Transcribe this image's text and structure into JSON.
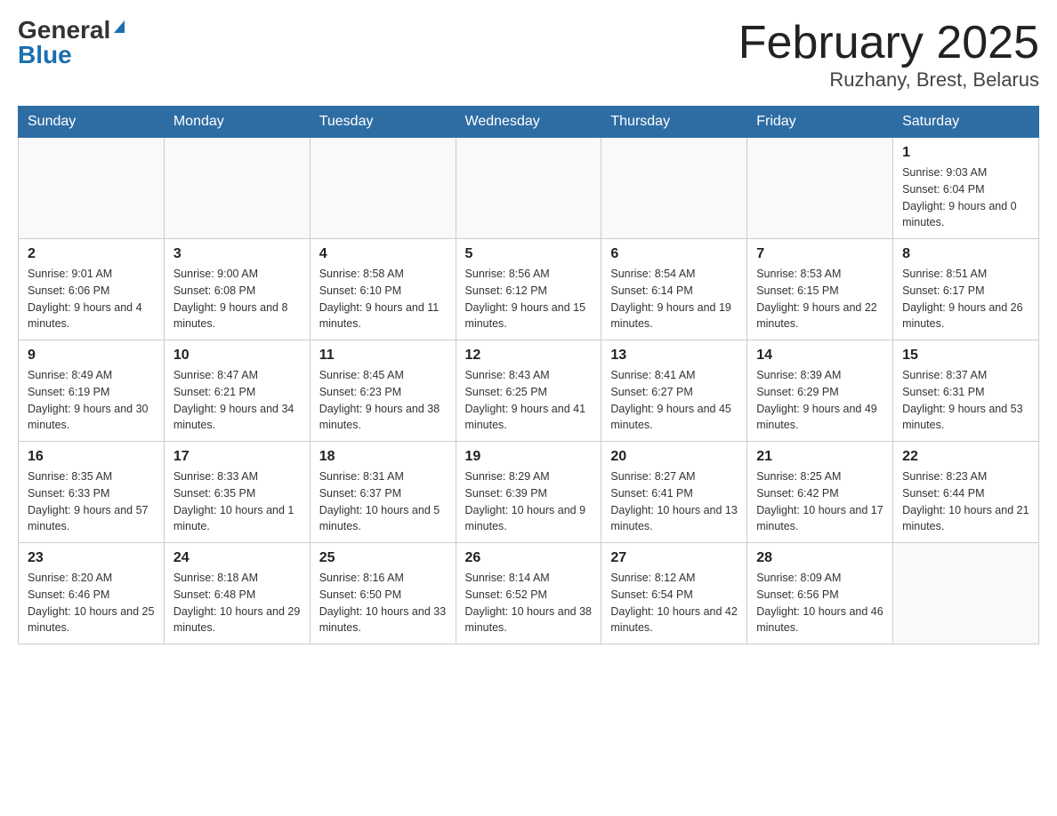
{
  "header": {
    "logo_general": "General",
    "logo_blue": "Blue",
    "month_title": "February 2025",
    "location": "Ruzhany, Brest, Belarus"
  },
  "weekdays": [
    "Sunday",
    "Monday",
    "Tuesday",
    "Wednesday",
    "Thursday",
    "Friday",
    "Saturday"
  ],
  "weeks": [
    [
      {
        "day": "",
        "info": ""
      },
      {
        "day": "",
        "info": ""
      },
      {
        "day": "",
        "info": ""
      },
      {
        "day": "",
        "info": ""
      },
      {
        "day": "",
        "info": ""
      },
      {
        "day": "",
        "info": ""
      },
      {
        "day": "1",
        "info": "Sunrise: 9:03 AM\nSunset: 6:04 PM\nDaylight: 9 hours and 0 minutes."
      }
    ],
    [
      {
        "day": "2",
        "info": "Sunrise: 9:01 AM\nSunset: 6:06 PM\nDaylight: 9 hours and 4 minutes."
      },
      {
        "day": "3",
        "info": "Sunrise: 9:00 AM\nSunset: 6:08 PM\nDaylight: 9 hours and 8 minutes."
      },
      {
        "day": "4",
        "info": "Sunrise: 8:58 AM\nSunset: 6:10 PM\nDaylight: 9 hours and 11 minutes."
      },
      {
        "day": "5",
        "info": "Sunrise: 8:56 AM\nSunset: 6:12 PM\nDaylight: 9 hours and 15 minutes."
      },
      {
        "day": "6",
        "info": "Sunrise: 8:54 AM\nSunset: 6:14 PM\nDaylight: 9 hours and 19 minutes."
      },
      {
        "day": "7",
        "info": "Sunrise: 8:53 AM\nSunset: 6:15 PM\nDaylight: 9 hours and 22 minutes."
      },
      {
        "day": "8",
        "info": "Sunrise: 8:51 AM\nSunset: 6:17 PM\nDaylight: 9 hours and 26 minutes."
      }
    ],
    [
      {
        "day": "9",
        "info": "Sunrise: 8:49 AM\nSunset: 6:19 PM\nDaylight: 9 hours and 30 minutes."
      },
      {
        "day": "10",
        "info": "Sunrise: 8:47 AM\nSunset: 6:21 PM\nDaylight: 9 hours and 34 minutes."
      },
      {
        "day": "11",
        "info": "Sunrise: 8:45 AM\nSunset: 6:23 PM\nDaylight: 9 hours and 38 minutes."
      },
      {
        "day": "12",
        "info": "Sunrise: 8:43 AM\nSunset: 6:25 PM\nDaylight: 9 hours and 41 minutes."
      },
      {
        "day": "13",
        "info": "Sunrise: 8:41 AM\nSunset: 6:27 PM\nDaylight: 9 hours and 45 minutes."
      },
      {
        "day": "14",
        "info": "Sunrise: 8:39 AM\nSunset: 6:29 PM\nDaylight: 9 hours and 49 minutes."
      },
      {
        "day": "15",
        "info": "Sunrise: 8:37 AM\nSunset: 6:31 PM\nDaylight: 9 hours and 53 minutes."
      }
    ],
    [
      {
        "day": "16",
        "info": "Sunrise: 8:35 AM\nSunset: 6:33 PM\nDaylight: 9 hours and 57 minutes."
      },
      {
        "day": "17",
        "info": "Sunrise: 8:33 AM\nSunset: 6:35 PM\nDaylight: 10 hours and 1 minute."
      },
      {
        "day": "18",
        "info": "Sunrise: 8:31 AM\nSunset: 6:37 PM\nDaylight: 10 hours and 5 minutes."
      },
      {
        "day": "19",
        "info": "Sunrise: 8:29 AM\nSunset: 6:39 PM\nDaylight: 10 hours and 9 minutes."
      },
      {
        "day": "20",
        "info": "Sunrise: 8:27 AM\nSunset: 6:41 PM\nDaylight: 10 hours and 13 minutes."
      },
      {
        "day": "21",
        "info": "Sunrise: 8:25 AM\nSunset: 6:42 PM\nDaylight: 10 hours and 17 minutes."
      },
      {
        "day": "22",
        "info": "Sunrise: 8:23 AM\nSunset: 6:44 PM\nDaylight: 10 hours and 21 minutes."
      }
    ],
    [
      {
        "day": "23",
        "info": "Sunrise: 8:20 AM\nSunset: 6:46 PM\nDaylight: 10 hours and 25 minutes."
      },
      {
        "day": "24",
        "info": "Sunrise: 8:18 AM\nSunset: 6:48 PM\nDaylight: 10 hours and 29 minutes."
      },
      {
        "day": "25",
        "info": "Sunrise: 8:16 AM\nSunset: 6:50 PM\nDaylight: 10 hours and 33 minutes."
      },
      {
        "day": "26",
        "info": "Sunrise: 8:14 AM\nSunset: 6:52 PM\nDaylight: 10 hours and 38 minutes."
      },
      {
        "day": "27",
        "info": "Sunrise: 8:12 AM\nSunset: 6:54 PM\nDaylight: 10 hours and 42 minutes."
      },
      {
        "day": "28",
        "info": "Sunrise: 8:09 AM\nSunset: 6:56 PM\nDaylight: 10 hours and 46 minutes."
      },
      {
        "day": "",
        "info": ""
      }
    ]
  ]
}
